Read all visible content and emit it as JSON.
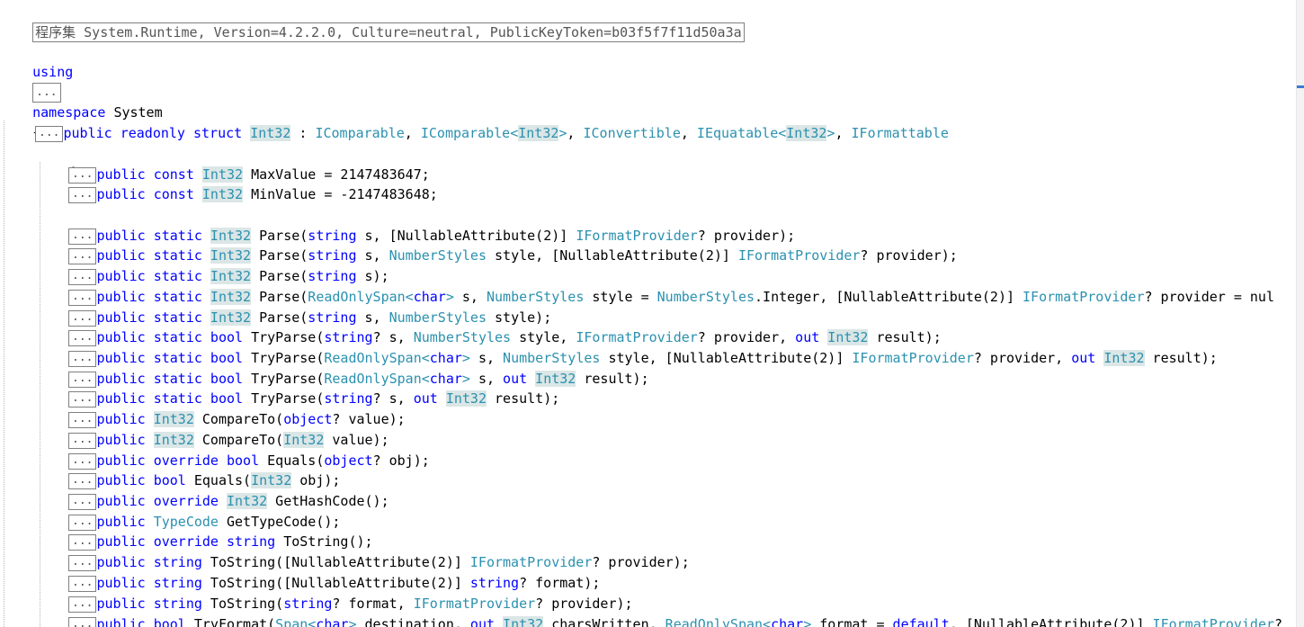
{
  "assembly_header": "程序集 System.Runtime, Version=4.2.2.0, Culture=neutral, PublicKeyToken=b03f5f7f11d50a3a",
  "fold_marker": "...",
  "using_kw": "using",
  "namespace_kw": "namespace",
  "namespace_name": "System",
  "open_brace": "{",
  "struct_decl": {
    "modifiers": "public readonly struct",
    "name": "Int32",
    "colon": " : ",
    "interfaces": [
      "IComparable",
      "IComparable",
      "Int32",
      "IConvertible",
      "IEquatable",
      "Int32",
      "IFormattable"
    ]
  },
  "members": [
    "public const Int32 MaxValue = 2147483647;",
    "public const Int32 MinValue = -2147483648;",
    "public static Int32 Parse(string s, [NullableAttribute(2)] IFormatProvider? provider);",
    "public static Int32 Parse(string s, NumberStyles style, [NullableAttribute(2)] IFormatProvider? provider);",
    "public static Int32 Parse(string s);",
    "public static Int32 Parse(ReadOnlySpan<char> s, NumberStyles style = NumberStyles.Integer, [NullableAttribute(2)] IFormatProvider? provider = nul",
    "public static Int32 Parse(string s, NumberStyles style);",
    "public static bool TryParse(string? s, NumberStyles style, IFormatProvider? provider, out Int32 result);",
    "public static bool TryParse(ReadOnlySpan<char> s, NumberStyles style, [NullableAttribute(2)] IFormatProvider? provider, out Int32 result);",
    "public static bool TryParse(ReadOnlySpan<char> s, out Int32 result);",
    "public static bool TryParse(string? s, out Int32 result);",
    "public Int32 CompareTo(object? value);",
    "public Int32 CompareTo(Int32 value);",
    "public override bool Equals(object? obj);",
    "public bool Equals(Int32 obj);",
    "public override Int32 GetHashCode();",
    "public TypeCode GetTypeCode();",
    "public override string ToString();",
    "public string ToString([NullableAttribute(2)] IFormatProvider? provider);",
    "public string ToString([NullableAttribute(2)] string? format);",
    "public string ToString(string? format, IFormatProvider? provider);",
    "public bool TryFormat(Span<char> destination, out Int32 charsWritten, ReadOnlySpan<char> format = default, [NullableAttribute(2)] IFormatProvider?"
  ],
  "colors": {
    "keyword": "#0000ff",
    "type": "#2b91af",
    "highlight": "#dbe6e6",
    "text": "#000000"
  }
}
